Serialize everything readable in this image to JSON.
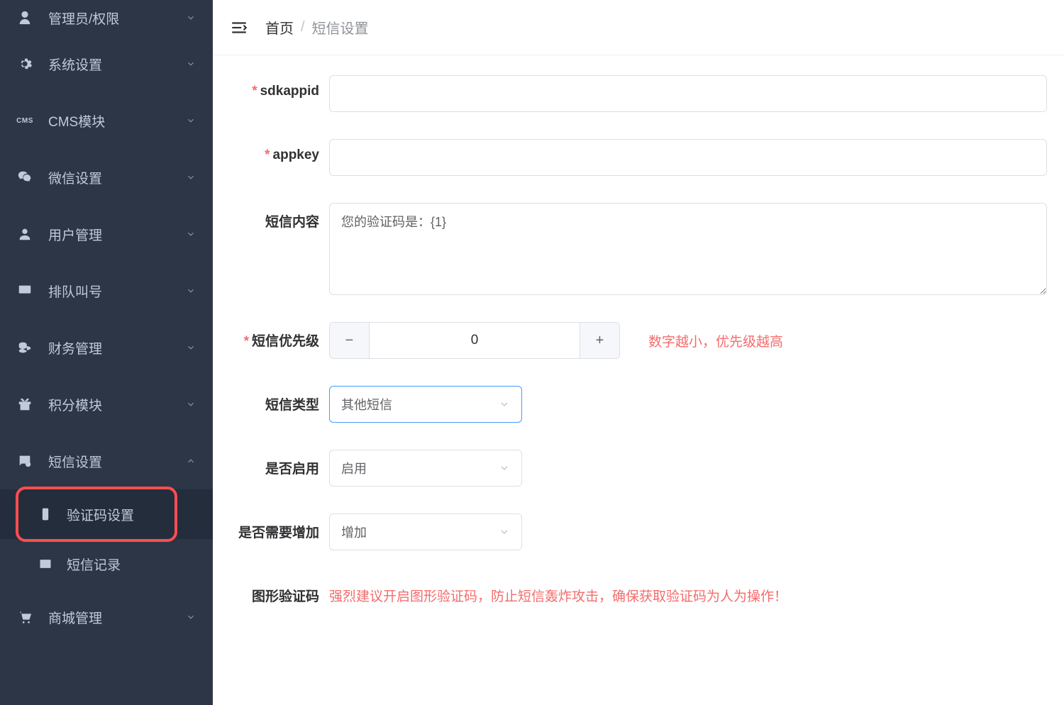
{
  "sidebar": {
    "items": [
      {
        "label": "管理员/权限"
      },
      {
        "label": "系统设置"
      },
      {
        "label": "CMS模块"
      },
      {
        "label": "微信设置"
      },
      {
        "label": "用户管理"
      },
      {
        "label": "排队叫号"
      },
      {
        "label": "财务管理"
      },
      {
        "label": "积分模块"
      },
      {
        "label": "短信设置"
      },
      {
        "label": "商城管理"
      }
    ],
    "sms_sub": {
      "code_settings": "验证码设置",
      "sms_log": "短信记录"
    }
  },
  "breadcrumb": {
    "home": "首页",
    "current": "短信设置",
    "sep": "/"
  },
  "form": {
    "sdkappid": {
      "label": "sdkappid",
      "value": ""
    },
    "appkey": {
      "label": "appkey",
      "value": ""
    },
    "sms_content": {
      "label": "短信内容",
      "value": "您的验证码是：{1}"
    },
    "priority": {
      "label": "短信优先级",
      "value": "0",
      "hint": "数字越小，优先级越高"
    },
    "sms_type": {
      "label": "短信类型",
      "value": "其他短信"
    },
    "enabled": {
      "label": "是否启用",
      "value": "启用"
    },
    "need_add": {
      "label": "是否需要增加",
      "value": "增加"
    },
    "captcha": {
      "label": "图形验证码",
      "hint": "强烈建议开启图形验证码，防止短信轰炸攻击，确保获取验证码为人为操作！"
    }
  }
}
